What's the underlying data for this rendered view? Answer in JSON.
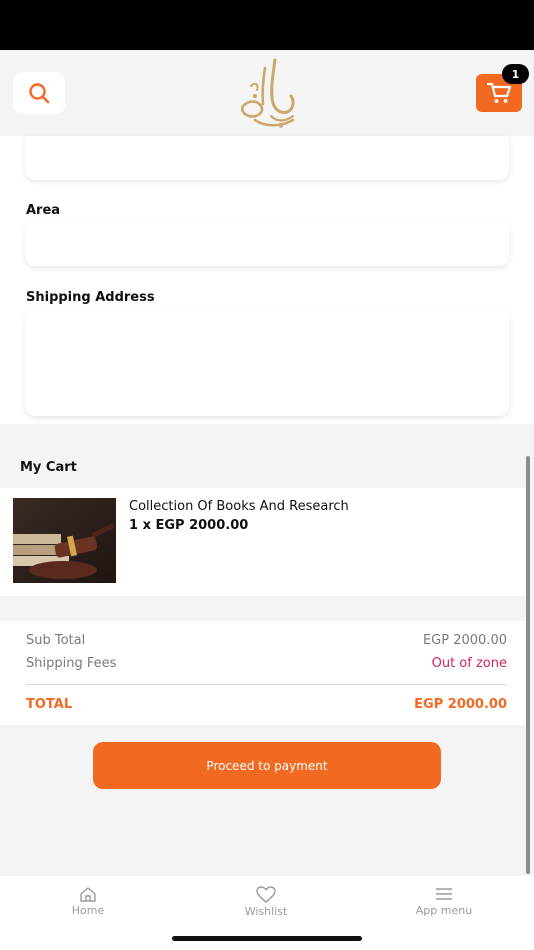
{
  "colors": {
    "accent": "#f26a22",
    "logo": "#c9a86a",
    "out_of_zone": "#d1245e"
  },
  "header": {
    "search_icon": "search-icon",
    "cart_icon": "cart-icon",
    "cart_count": "1"
  },
  "form": {
    "area_label": "Area",
    "area_value": "",
    "shipping_address_label": "Shipping Address",
    "shipping_address_value": ""
  },
  "cart": {
    "title": "My Cart",
    "items": [
      {
        "name": "Collection Of Books And Research",
        "price": "1 x EGP 2000.00"
      }
    ]
  },
  "summary": {
    "subtotal_label": "Sub Total",
    "subtotal_value": "EGP 2000.00",
    "shipping_label": "Shipping Fees",
    "shipping_value": "Out of zone",
    "total_label": "TOTAL",
    "total_value": "EGP 2000.00"
  },
  "actions": {
    "proceed_label": "Proceed to payment"
  },
  "nav": {
    "home": "Home",
    "wishlist": "Wishlist",
    "menu": "App menu"
  }
}
